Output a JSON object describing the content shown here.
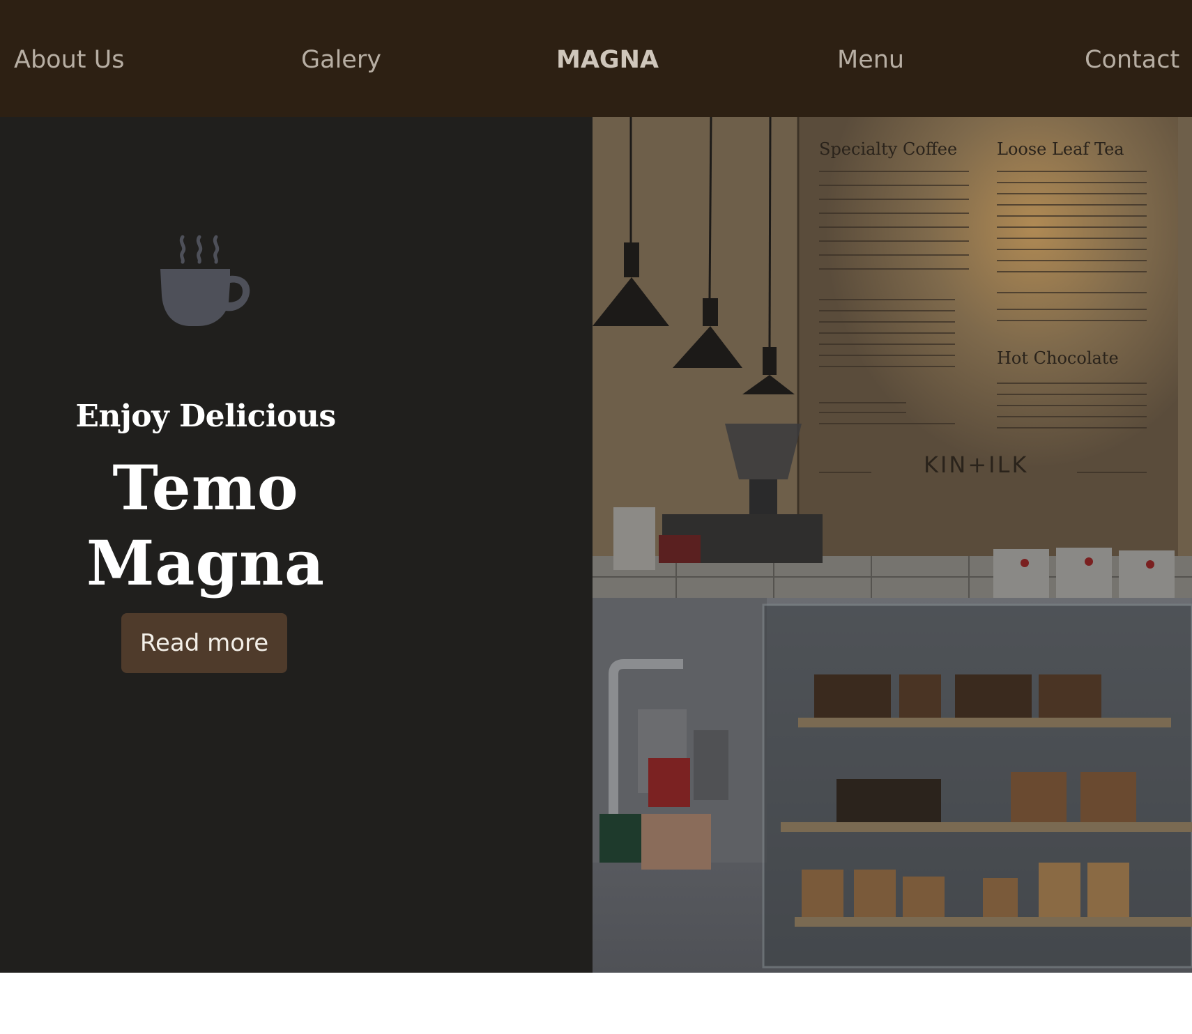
{
  "nav": {
    "about_label": "About Us",
    "gallery_label": "Galery",
    "brand": "MAGNA",
    "menu_label": "Menu",
    "contact_label": "Contact"
  },
  "hero": {
    "icon": "coffee-cup-icon",
    "subtitle": "Enjoy Delicious",
    "title_line1": "Temo",
    "title_line2": "Magna",
    "button_label": "Read more"
  },
  "photo": {
    "board_heading_left": "Specialty Coffee",
    "board_heading_right": "Loose Leaf Tea",
    "board_heading_chocolate": "Hot Chocolate",
    "board_logo": "KIN+ILK"
  },
  "colors": {
    "navbar_bg": "#2d2013",
    "hero_left_bg": "#201f1d",
    "button_bg": "#4f3b2b",
    "icon_color": "#4e5059"
  }
}
